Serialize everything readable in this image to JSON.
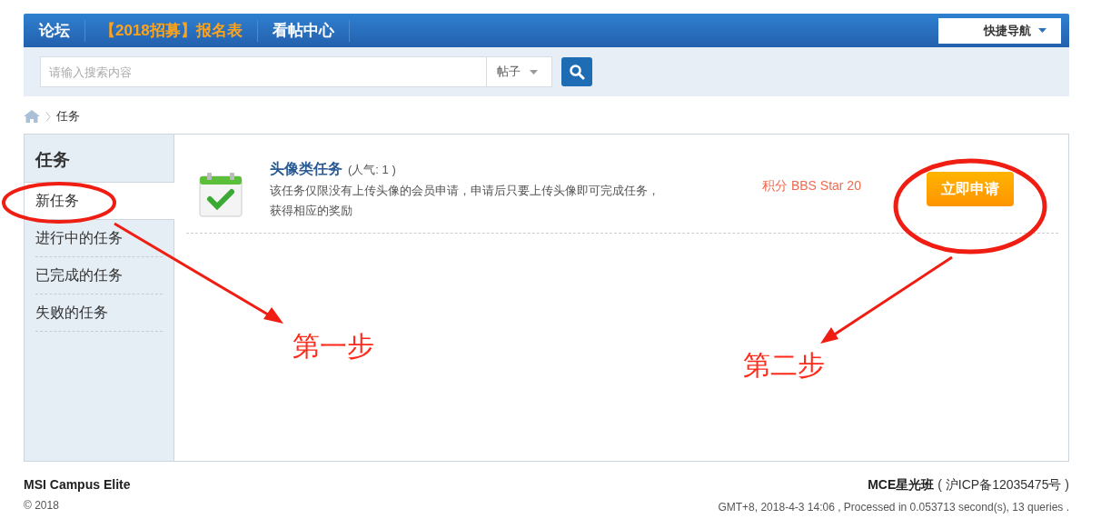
{
  "nav": {
    "links": [
      {
        "label": "论坛",
        "kind": "plain"
      },
      {
        "label": "【2018招募】报名表",
        "kind": "highlight"
      },
      {
        "label": "看帖中心",
        "kind": "plain"
      }
    ],
    "quick_nav": "快捷导航"
  },
  "search": {
    "placeholder": "请输入搜索内容",
    "scope": "帖子"
  },
  "breadcrumb": [
    "任务"
  ],
  "sidebar": {
    "title": "任务",
    "items": [
      {
        "label": "新任务",
        "selected": true
      },
      {
        "label": "进行中的任务",
        "selected": false
      },
      {
        "label": "已完成的任务",
        "selected": false
      },
      {
        "label": "失败的任务",
        "selected": false
      }
    ]
  },
  "tasks": [
    {
      "title": "头像类任务",
      "popularity": "(人气: 1 )",
      "description": "该任务仅限没有上传头像的会员申请，申请后只要上传头像即可完成任务，获得相应的奖励",
      "reward": "积分 BBS Star 20",
      "action": "立即申请"
    }
  ],
  "annotations": [
    {
      "text": "第一步"
    },
    {
      "text": "第二步"
    }
  ],
  "footer": {
    "site": "MSI Campus Elite",
    "copyright": "© 2018",
    "icp_name": "MCE星光班",
    "icp": "( 沪ICP备12035475号 )",
    "stats": "GMT+8, 2018-4-3 14:06 , Processed in 0.053713 second(s), 13 queries ."
  }
}
